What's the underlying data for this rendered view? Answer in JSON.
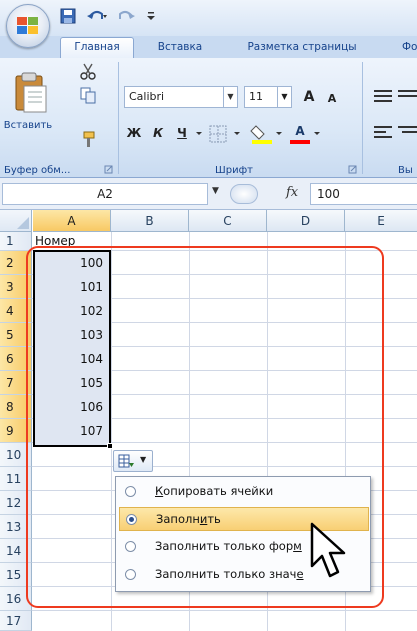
{
  "ribbon": {
    "tabs": {
      "home": "Главная",
      "insert": "Вставка",
      "page_layout": "Разметка страницы",
      "formulas": "Фо"
    },
    "clipboard": {
      "paste_label": "Вставить",
      "group_label": "Буфер обм..."
    },
    "font": {
      "name": "Calibri",
      "size": "11",
      "grow_label": "A",
      "shrink_label": "A",
      "bold_label": "Ж",
      "italic_label": "К",
      "underline_label": "Ч",
      "font_color_label": "A",
      "group_label": "Шрифт"
    },
    "next_group_label": "Вы"
  },
  "formula_bar": {
    "name_box": "A2",
    "fx_label": "fx",
    "value": "100"
  },
  "grid": {
    "columns": [
      "A",
      "B",
      "C",
      "D",
      "E"
    ],
    "rows": [
      "1",
      "2",
      "3",
      "4",
      "5",
      "6",
      "7",
      "8",
      "9",
      "10",
      "11",
      "12",
      "13",
      "14",
      "15",
      "16",
      "17"
    ],
    "a1_header": "Номер",
    "values": [
      "100",
      "101",
      "102",
      "103",
      "104",
      "105",
      "106",
      "107"
    ]
  },
  "autofill_menu": {
    "items": [
      {
        "pre": "",
        "hot": "К",
        "post": "опировать ячейки",
        "selected": false
      },
      {
        "pre": "Заполн",
        "hot": "и",
        "post": "ть",
        "selected": true
      },
      {
        "pre": "Заполнить только фор",
        "hot": "м",
        "post": "",
        "selected": false
      },
      {
        "pre": "Заполнить только знач",
        "hot": "е",
        "post": "",
        "selected": false
      }
    ]
  },
  "colors": {
    "highlight_frame": "#ee3a1f",
    "selected_menu_item": "#f8cf74",
    "ribbon_text": "#15428b"
  }
}
